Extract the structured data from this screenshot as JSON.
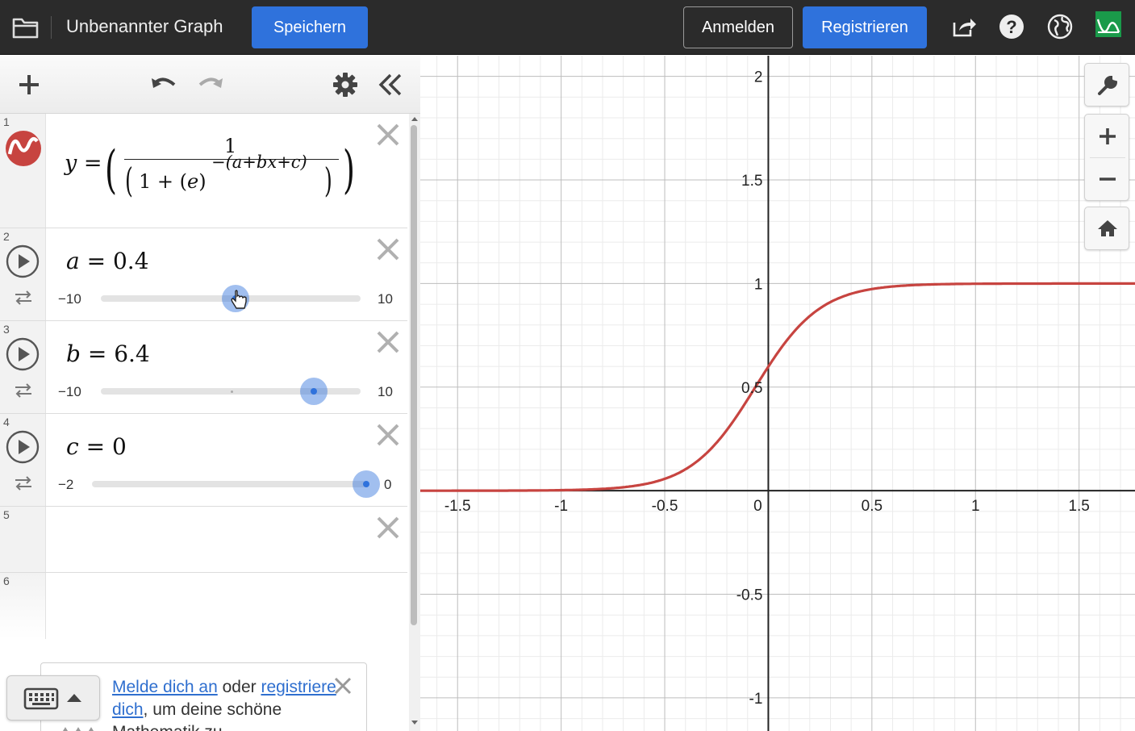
{
  "topbar": {
    "title": "Unbenannter Graph",
    "save_label": "Speichern",
    "login_label": "Anmelden",
    "register_label": "Registrieren"
  },
  "expressions": [
    {
      "index": "1",
      "lhs": "y",
      "eq": "=",
      "numerator": "1",
      "den_one": "1",
      "den_plus": "+",
      "den_base": "e",
      "exponent": "−(a+bx+c)"
    },
    {
      "index": "2",
      "var": "a",
      "eq": "=",
      "value": "0.4",
      "min": "−10",
      "max": "10",
      "slider_value": 0.4,
      "slider_min": -10,
      "slider_max": 10
    },
    {
      "index": "3",
      "var": "b",
      "eq": "=",
      "value": "6.4",
      "min": "−10",
      "max": "10",
      "slider_value": 6.4,
      "slider_min": -10,
      "slider_max": 10
    },
    {
      "index": "4",
      "var": "c",
      "eq": "=",
      "value": "0",
      "min": "−2",
      "max": "0",
      "slider_value": 0,
      "slider_min": -2,
      "slider_max": 0
    },
    {
      "index": "5"
    },
    {
      "index": "6"
    }
  ],
  "promo": {
    "link1": "Melde dich an",
    "middle": " oder ",
    "link2": "registriere dich",
    "rest": ", um deine schöne Mathematik zu"
  },
  "graph": {
    "x_ticks": [
      "-1.5",
      "-1",
      "-0.5",
      "0",
      "0.5",
      "1",
      "1.5"
    ],
    "y_ticks": [
      "2",
      "1.5",
      "1",
      "0.5",
      "-0.5",
      "-1"
    ],
    "curve_color": "#c74440",
    "xlim": [
      -1.68,
      1.77
    ],
    "ylim": [
      -1.16,
      2.1
    ]
  },
  "colors": {
    "accent": "#2f72dc",
    "topbar": "#2b2b2b",
    "curve": "#c74440"
  },
  "icons": [
    "folder-icon",
    "share-icon",
    "help-icon",
    "globe-icon",
    "desmos-logo-icon",
    "add-icon",
    "undo-icon",
    "redo-icon",
    "gear-icon",
    "collapse-icon",
    "close-icon",
    "play-icon",
    "loop-icon",
    "keyboard-icon",
    "wrench-icon",
    "zoom-in-icon",
    "zoom-out-icon",
    "home-icon"
  ]
}
